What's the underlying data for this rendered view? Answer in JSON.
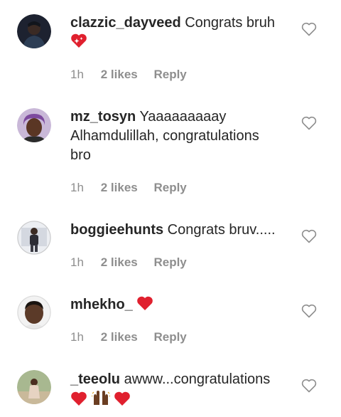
{
  "comments": [
    {
      "username": "clazzic_dayveed",
      "text": "Congrats bruh",
      "emoji": [
        "sparkling-heart"
      ],
      "time": "1h",
      "likes": "2 likes",
      "reply": "Reply"
    },
    {
      "username": "mz_tosyn",
      "text": "Yaaaaaaaaay Alhamdulillah, congratulations bro",
      "time": "1h",
      "likes": "2 likes",
      "reply": "Reply"
    },
    {
      "username": "boggieehunts",
      "text": "Congrats bruv.....",
      "time": "1h",
      "likes": "2 likes",
      "reply": "Reply"
    },
    {
      "username": "mhekho_",
      "text": "",
      "emoji": [
        "red-heart"
      ],
      "time": "1h",
      "likes": "2 likes",
      "reply": "Reply"
    },
    {
      "username": "_teeolu",
      "text": "awww...congratulations",
      "emoji": [
        "red-heart",
        "raising-hands-dark",
        "red-heart"
      ],
      "time": "",
      "likes": "",
      "reply": ""
    }
  ],
  "colors": {
    "text": "#262626",
    "meta": "#8e8e8e",
    "heart": "#e0202e",
    "outline": "#8e8e8e"
  }
}
